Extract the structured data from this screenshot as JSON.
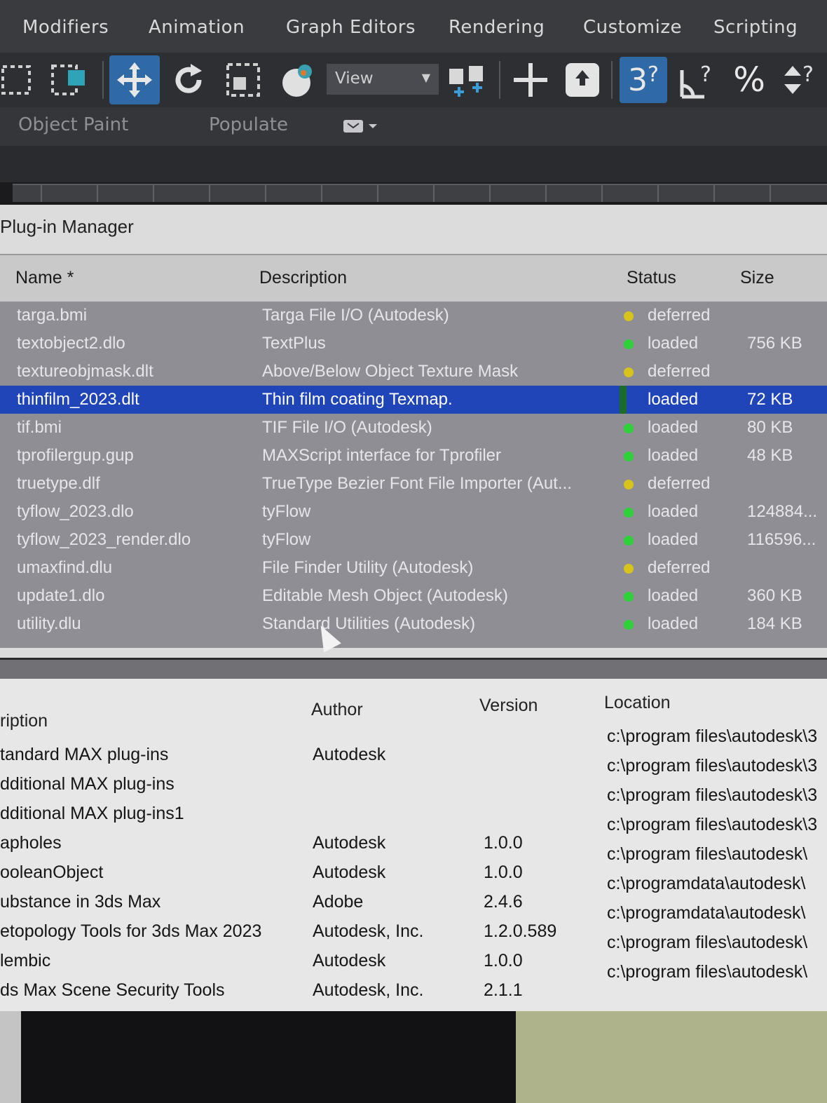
{
  "menubar": {
    "items": [
      "Modifiers",
      "Animation",
      "Graph Editors",
      "Rendering",
      "Customize",
      "Scripting"
    ]
  },
  "toolbar": {
    "view_select": "View",
    "icons": [
      "select-region-icon",
      "select-window-icon",
      "move-icon",
      "rotate-icon",
      "scale-icon",
      "placement-icon",
      "view-dropdown",
      "pivot-icon",
      "snap-toggle-icon",
      "align-icon",
      "angle-snap-icon",
      "percent-snap-icon",
      "spinner-snap-icon"
    ]
  },
  "ribbon": {
    "items": [
      "Object Paint",
      "Populate"
    ]
  },
  "window": {
    "title": "Plug-in Manager"
  },
  "plugin_list": {
    "columns": [
      "Name *",
      "Description",
      "Status",
      "Size"
    ],
    "rows": [
      {
        "name": "targa.bmi",
        "description": "Targa File I/O (Autodesk)",
        "status": "deferred",
        "size": ""
      },
      {
        "name": "textobject2.dlo",
        "description": "TextPlus",
        "status": "loaded",
        "size": "756 KB"
      },
      {
        "name": "textureobjmask.dlt",
        "description": "Above/Below Object Texture Mask",
        "status": "deferred",
        "size": ""
      },
      {
        "name": "thinfilm_2023.dlt",
        "description": "Thin film coating Texmap.",
        "status": "loaded",
        "size": "72 KB"
      },
      {
        "name": "tif.bmi",
        "description": "TIF File I/O (Autodesk)",
        "status": "loaded",
        "size": "80 KB"
      },
      {
        "name": "tprofilergup.gup",
        "description": "MAXScript interface for Tprofiler",
        "status": "loaded",
        "size": "48 KB"
      },
      {
        "name": "truetype.dlf",
        "description": "TrueType Bezier Font File Importer (Aut...",
        "status": "deferred",
        "size": ""
      },
      {
        "name": "tyflow_2023.dlo",
        "description": "tyFlow",
        "status": "loaded",
        "size": "124884..."
      },
      {
        "name": "tyflow_2023_render.dlo",
        "description": "tyFlow",
        "status": "loaded",
        "size": "116596..."
      },
      {
        "name": "umaxfind.dlu",
        "description": "File Finder Utility (Autodesk)",
        "status": "deferred",
        "size": ""
      },
      {
        "name": "update1.dlo",
        "description": "Editable Mesh Object (Autodesk)",
        "status": "loaded",
        "size": "360 KB"
      },
      {
        "name": "utility.dlu",
        "description": "Standard Utilities (Autodesk)",
        "status": "loaded",
        "size": "184 KB"
      }
    ],
    "selected_index": 3,
    "status_colors": {
      "loaded": "#2fd03a",
      "deferred": "#d8c21c"
    }
  },
  "details": {
    "columns": [
      "ription",
      "Author",
      "Version",
      "Location"
    ],
    "rows": [
      {
        "description": "tandard MAX plug-ins",
        "author": "Autodesk",
        "version": "",
        "location": "c:\\program files\\autodesk\\3"
      },
      {
        "description": "dditional MAX plug-ins",
        "author": "",
        "version": "",
        "location": "c:\\program files\\autodesk\\3"
      },
      {
        "description": "dditional MAX plug-ins1",
        "author": "",
        "version": "",
        "location": "c:\\program files\\autodesk\\3"
      },
      {
        "description": "apholes",
        "author": "Autodesk",
        "version": "1.0.0",
        "location": "c:\\program files\\autodesk\\3"
      },
      {
        "description": "ooleanObject",
        "author": "Autodesk",
        "version": "1.0.0",
        "location": "c:\\program files\\autodesk\\"
      },
      {
        "description": "ubstance in 3ds Max",
        "author": "Adobe",
        "version": "2.4.6",
        "location": "c:\\programdata\\autodesk\\"
      },
      {
        "description": "etopology Tools for 3ds Max 2023",
        "author": "Autodesk, Inc.",
        "version": "1.2.0.589",
        "location": "c:\\programdata\\autodesk\\"
      },
      {
        "description": "lembic",
        "author": "Autodesk",
        "version": "1.0.0",
        "location": "c:\\program files\\autodesk\\"
      },
      {
        "description": "ds Max Scene Security Tools",
        "author": "Autodesk, Inc.",
        "version": "2.1.1",
        "location": "c:\\program files\\autodesk\\"
      }
    ]
  }
}
